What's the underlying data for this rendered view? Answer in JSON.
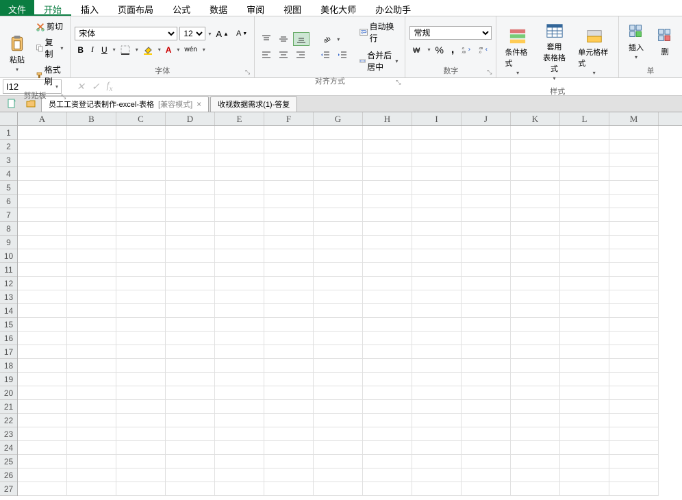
{
  "menu": {
    "file": "文件",
    "items": [
      "开始",
      "插入",
      "页面布局",
      "公式",
      "数据",
      "审阅",
      "视图",
      "美化大师",
      "办公助手"
    ]
  },
  "ribbon": {
    "clipboard": {
      "label": "剪贴板",
      "paste": "粘贴",
      "cut": "剪切",
      "copy": "复制",
      "format_painter": "格式刷"
    },
    "font": {
      "label": "字体",
      "name": "宋体",
      "size": "12",
      "bold": "B",
      "italic": "I",
      "underline": "U",
      "pinyin": "wén"
    },
    "align": {
      "label": "对齐方式",
      "wrap": "自动换行",
      "merge": "合并后居中"
    },
    "number": {
      "label": "数字",
      "format": "常规",
      "percent": "%"
    },
    "styles": {
      "label": "样式",
      "cond": "条件格式",
      "table": "套用\n表格格式",
      "cell": "单元格样式"
    },
    "cells": {
      "label": "单",
      "insert": "插入",
      "delete": "删"
    }
  },
  "namebox": "I12",
  "doc_tabs": {
    "tab1": {
      "name": "员工工资登记表制作-excel-表格",
      "compat": "[兼容模式]"
    },
    "tab2": {
      "name": "收视数据需求(1)-答复"
    }
  },
  "grid": {
    "cols": [
      "A",
      "B",
      "C",
      "D",
      "E",
      "F",
      "G",
      "H",
      "I",
      "J",
      "K",
      "L",
      "M"
    ],
    "rows": [
      1,
      2,
      3,
      4,
      5,
      6,
      7,
      8,
      9,
      10,
      11,
      12,
      13,
      14,
      15,
      16,
      17,
      18,
      19,
      20,
      21,
      22,
      23,
      24,
      25,
      26,
      27
    ]
  }
}
